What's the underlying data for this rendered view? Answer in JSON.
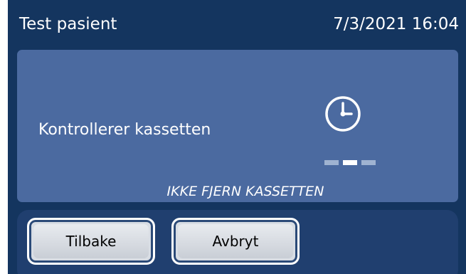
{
  "header": {
    "title": "Test pasient",
    "datetime": "7/3/2021 16:04"
  },
  "status": {
    "message": "Kontrollerer kassetten",
    "icon": "clock-icon",
    "progress": {
      "steps": 3,
      "active_index": 1
    },
    "warning": "IKKE FJERN KASSETTEN"
  },
  "buttons": {
    "back_label": "Tilbake",
    "cancel_label": "Avbryt"
  },
  "colors": {
    "background": "#14355f",
    "panel": "#4b6aa0",
    "button_bar": "#203f6f",
    "progress_active": "#ffffff",
    "progress_inactive": "#9fb3d1"
  }
}
